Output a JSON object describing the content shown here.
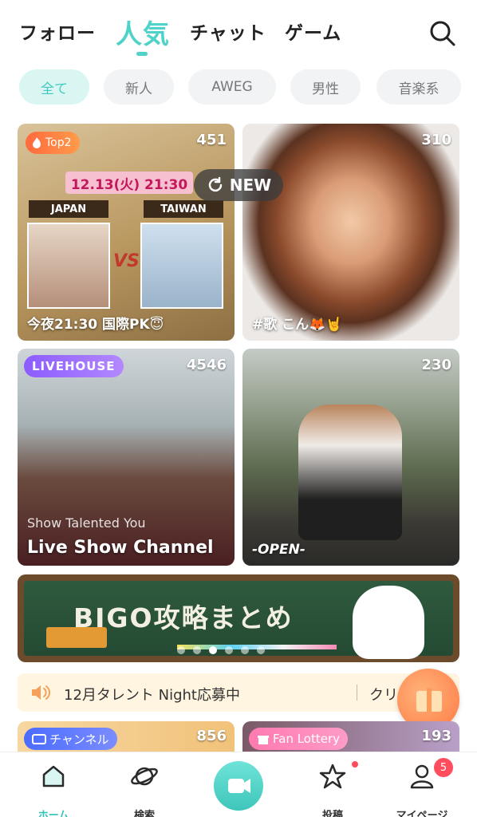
{
  "top_nav": {
    "tabs": [
      {
        "label": "フォロー"
      },
      {
        "label": "人気"
      },
      {
        "label": "チャット"
      },
      {
        "label": "ゲーム"
      }
    ],
    "search_icon": "search-icon"
  },
  "filters": [
    "全て",
    "新人",
    "AWEG",
    "男性",
    "音楽系"
  ],
  "cards": [
    {
      "badge": "Top2",
      "viewers": "451",
      "caption": "今夜21:30 国際PK😇",
      "poster_text": {
        "date": "12.13(火) 21:30",
        "left_team": "JAPAN",
        "right_team": "TAIWAN"
      }
    },
    {
      "viewers": "310",
      "caption": "#歌 こん🦊🤘"
    },
    {
      "badge": "LIVEHOUSE",
      "viewers": "4546",
      "subtitle": "Show Talented You",
      "caption": "Live Show Channel"
    },
    {
      "viewers": "230",
      "caption": "-OPEN-"
    }
  ],
  "new_badge": "NEW",
  "banner": {
    "title": "BIGO攻略まとめ"
  },
  "notice": {
    "text": "12月タレント Night応募中",
    "text2": "クリスマ"
  },
  "bottom_cards": [
    {
      "badge": "チャンネル",
      "viewers": "856"
    },
    {
      "badge": "Fan Lottery",
      "viewers": "193"
    }
  ],
  "tabbar": {
    "items": [
      {
        "label": "ホーム"
      },
      {
        "label": "検索"
      },
      {
        "label": "投稿"
      },
      {
        "label": "マイページ"
      }
    ],
    "badge_count": "5"
  },
  "colors": {
    "accent": "#4fd2c7",
    "badge_red": "#ff4d5e"
  }
}
